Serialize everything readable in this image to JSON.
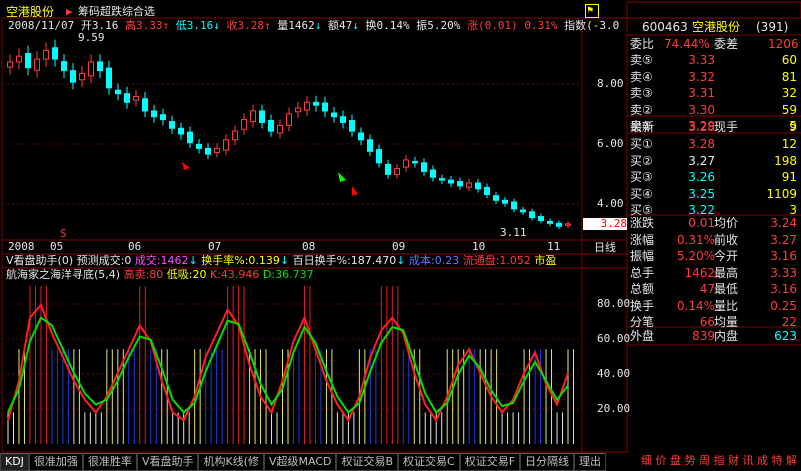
{
  "header": {
    "stock_name": "空港股份",
    "flag_label": "筹码超跌综合选",
    "date": "2008/11/07",
    "open_label": "开",
    "open": "3.16",
    "high_label": "高",
    "high": "3.33",
    "low_label": "低",
    "low": "3.16",
    "close_label": "收",
    "close": "3.28",
    "vol_label": "量",
    "vol": "1462",
    "amount_label": "额",
    "amount": "47",
    "turnover_label": "换",
    "turnover": "0.14%",
    "amplitude_label": "振",
    "amplitude": "5.20%",
    "change_label": "涨",
    "change": "(0.01)",
    "change_pct": "0.31%",
    "index_label": "指数",
    "index": "(-3.0"
  },
  "price_axis": [
    "8.00",
    "6.00",
    "4.00"
  ],
  "price_tag": "3.28",
  "marks": {
    "max_label": "9.59",
    "min_label": "3.11",
    "s_mark": "S"
  },
  "time_axis": [
    "2008",
    "05",
    "06",
    "07",
    "08",
    "09",
    "10",
    "11"
  ],
  "period_label": "日线",
  "indicator_bar": {
    "name": "V看盘助手(0)",
    "pred_label": "预测成交:0",
    "vol_label": "成交:1462",
    "turn_label": "换手率%:0.139",
    "hundred_label": "百日换手%:187.470",
    "cost_label": "成本:0.23",
    "float_label": "流通盘:1.052",
    "market_label": "市盈"
  },
  "kdj_bar": {
    "name": "航海家之海洋寻底(5,4)",
    "high_label": "高卖:80",
    "low_label": "低吸:20",
    "k_label": "K:43.946",
    "d_label": "D:36.737"
  },
  "kdj_axis": [
    "80.00",
    "60.00",
    "40.00",
    "20.00"
  ],
  "chart_data": {
    "type": "line",
    "title": "",
    "price_series_close": [
      8.9,
      9.1,
      8.7,
      9.0,
      9.3,
      9.0,
      8.6,
      8.2,
      8.5,
      8.9,
      8.6,
      8.0,
      7.8,
      7.5,
      7.7,
      7.2,
      7.0,
      6.9,
      6.6,
      6.4,
      6.1,
      5.9,
      5.7,
      5.9,
      6.2,
      6.5,
      6.9,
      7.2,
      6.8,
      6.5,
      6.7,
      7.1,
      7.3,
      7.5,
      7.4,
      7.2,
      7.0,
      6.8,
      6.5,
      6.2,
      5.8,
      5.4,
      5.0,
      5.2,
      5.5,
      5.4,
      5.1,
      4.9,
      4.8,
      4.7,
      4.6,
      4.7,
      4.5,
      4.3,
      4.1,
      4.0,
      3.8,
      3.7,
      3.5,
      3.4,
      3.3,
      3.2,
      3.28
    ],
    "k_values": [
      15,
      40,
      80,
      88,
      70,
      55,
      40,
      28,
      20,
      30,
      45,
      60,
      75,
      65,
      40,
      20,
      15,
      30,
      55,
      70,
      85,
      75,
      50,
      30,
      20,
      40,
      65,
      80,
      60,
      40,
      25,
      15,
      30,
      55,
      72,
      80,
      70,
      45,
      25,
      15,
      30,
      50,
      60,
      45,
      30,
      20,
      28,
      45,
      58,
      38,
      25,
      45
    ],
    "d_values": [
      20,
      35,
      65,
      80,
      75,
      60,
      45,
      32,
      25,
      28,
      40,
      55,
      68,
      66,
      48,
      28,
      20,
      26,
      46,
      62,
      78,
      76,
      58,
      38,
      25,
      35,
      58,
      74,
      64,
      46,
      30,
      20,
      26,
      46,
      64,
      74,
      72,
      52,
      32,
      20,
      26,
      44,
      56,
      48,
      34,
      24,
      26,
      40,
      52,
      40,
      28,
      37
    ],
    "ylim_price": [
      3.0,
      9.8
    ],
    "ylim_kdj": [
      0,
      100
    ]
  },
  "right_panel": {
    "code": "600463",
    "name": "空港股份",
    "serial": "(391)",
    "wei_bi_label": "委比",
    "wei_bi": "74.44%",
    "wei_cha_label": "委差",
    "wei_cha": "1206",
    "sell": [
      {
        "label": "卖⑤",
        "price": "3.33",
        "vol": "60"
      },
      {
        "label": "卖④",
        "price": "3.32",
        "vol": "81"
      },
      {
        "label": "卖③",
        "price": "3.31",
        "vol": "32"
      },
      {
        "label": "卖②",
        "price": "3.30",
        "vol": "59"
      },
      {
        "label": "卖①",
        "price": "3.29",
        "vol": "5"
      }
    ],
    "latest_label": "最新",
    "latest": "3.28",
    "now_hand_label": "现手",
    "now_hand": "9",
    "buy": [
      {
        "label": "买①",
        "price": "3.28",
        "vol": "12"
      },
      {
        "label": "买②",
        "price": "3.27",
        "vol": "198"
      },
      {
        "label": "买③",
        "price": "3.26",
        "vol": "91"
      },
      {
        "label": "买④",
        "price": "3.25",
        "vol": "1109"
      },
      {
        "label": "买⑤",
        "price": "3.22",
        "vol": "3"
      }
    ],
    "stats": [
      {
        "l1": "涨跌",
        "v1": "0.01",
        "l2": "均价",
        "v2": "3.24"
      },
      {
        "l1": "涨幅",
        "v1": "0.31%",
        "l2": "前收",
        "v2": "3.27"
      },
      {
        "l1": "振幅",
        "v1": "5.20%",
        "l2": "今开",
        "v2": "3.16"
      },
      {
        "l1": "总手",
        "v1": "1462",
        "l2": "最高",
        "v2": "3.33"
      },
      {
        "l1": "总额",
        "v1": "47",
        "l2": "最低",
        "v2": "3.16"
      },
      {
        "l1": "换手",
        "v1": "0.14%",
        "l2": "量比",
        "v2": "0.25"
      },
      {
        "l1": "分笔",
        "v1": "66",
        "l2": "均量",
        "v2": "22"
      }
    ],
    "outer_label": "外盘",
    "outer": "839",
    "inner_label": "内盘",
    "inner": "623"
  },
  "tabs": [
    "KDJ",
    "很准加强",
    "很准胜率",
    "V看盘助手",
    "机构K线(修",
    "V超级MACD",
    "权证交易B",
    "权证交易C",
    "权证交易F",
    "日分隔线",
    "理出"
  ],
  "footer_links": "细 价 盘 势 周 指 财 讯 成 特 解",
  "colors": {
    "up": "#ff3c3c",
    "down": "#00ffff",
    "k": "#ff2020",
    "d": "#00e000",
    "grid": "#800000"
  }
}
